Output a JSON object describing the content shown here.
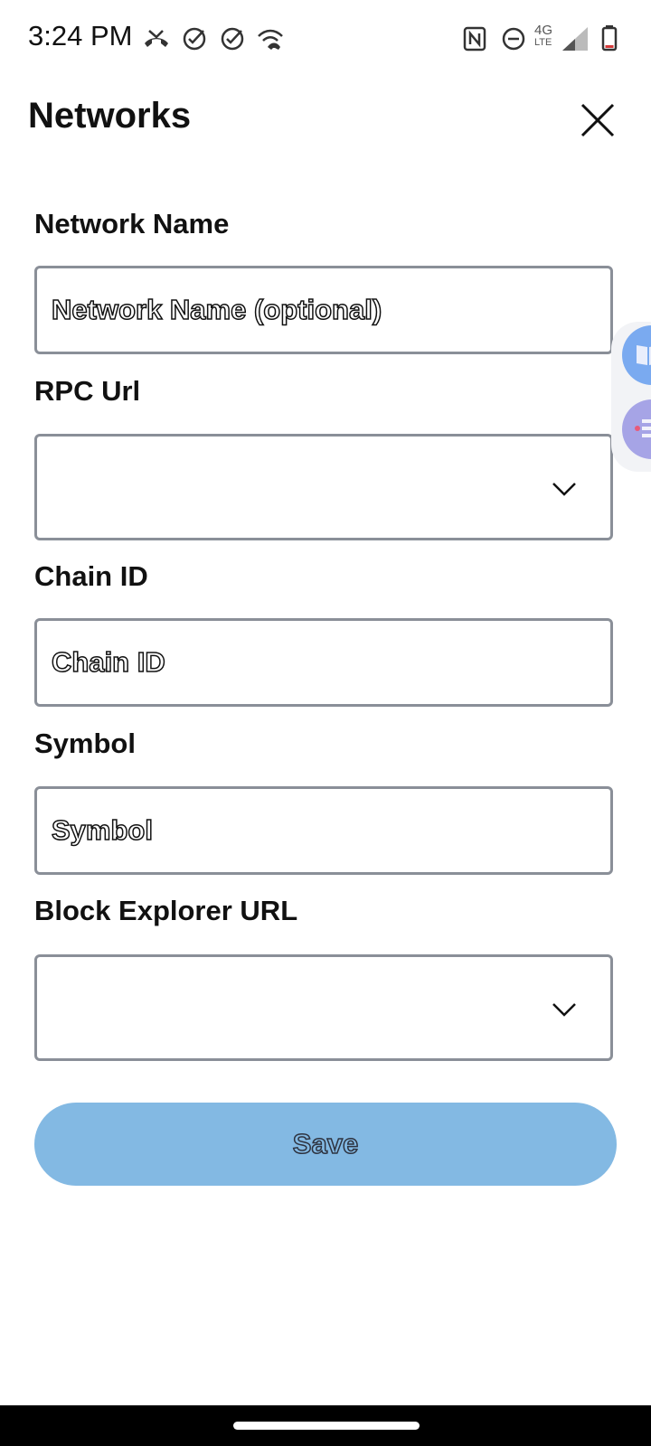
{
  "status_bar": {
    "time": "3:24 PM",
    "network_type_top": "4G",
    "network_type_bottom": "LTE"
  },
  "header": {
    "title": "Networks"
  },
  "form": {
    "network_name": {
      "label": "Network Name",
      "placeholder": "Network Name (optional)",
      "value": ""
    },
    "rpc_url": {
      "label": "RPC Url",
      "value": ""
    },
    "chain_id": {
      "label": "Chain ID",
      "placeholder": "Chain ID",
      "value": ""
    },
    "symbol": {
      "label": "Symbol",
      "placeholder": "Symbol",
      "value": ""
    },
    "block_explorer_url": {
      "label": "Block Explorer URL",
      "value": ""
    }
  },
  "actions": {
    "save_label": "Save"
  },
  "colors": {
    "save_button_bg": "#83b9e3",
    "field_border": "#8a8f98",
    "bubble_top": "#7aaaf0",
    "bubble_bottom": "#a6a4e6"
  },
  "icons": {
    "status_left": [
      "missed-call-icon",
      "check-circle-icon",
      "check-circle-icon",
      "wifi-calling-icon"
    ],
    "status_right": [
      "nfc-icon",
      "do-not-disturb-icon",
      "signal-icon",
      "battery-icon"
    ],
    "close": "close-icon",
    "dropdown": "chevron-down-icon"
  }
}
